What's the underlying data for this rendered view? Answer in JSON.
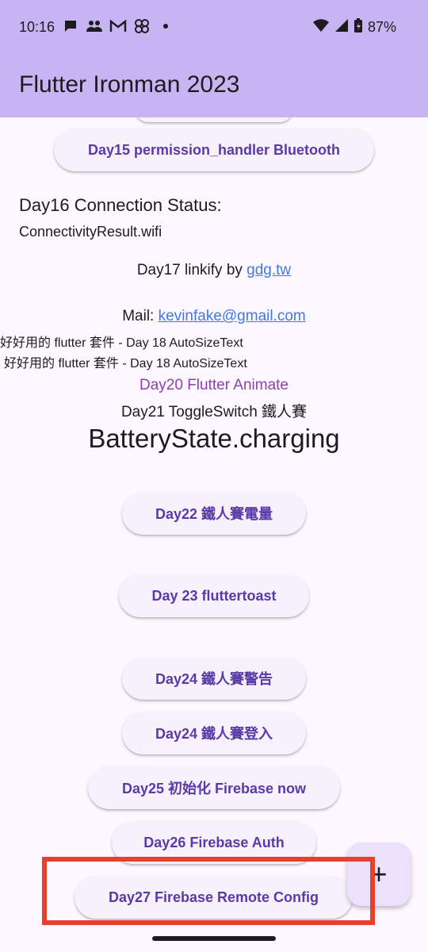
{
  "status_bar": {
    "time": "10:16",
    "battery": "87%",
    "icons": [
      "chat-icon",
      "people-icon",
      "gmail-icon",
      "pinwheel-icon",
      "dot-icon",
      "wifi-icon",
      "signal-icon",
      "battery-icon"
    ]
  },
  "app_bar": {
    "title": "Flutter Ironman 2023"
  },
  "content": {
    "btn_day15": "Day15 permission_handler Bluetooth",
    "day16_title": "Day16 Connection Status:",
    "day16_value": "ConnectivityResult.wifi",
    "day17_prefix": "Day17 linkify by ",
    "day17_link": "gdg.tw",
    "mail_prefix": "Mail: ",
    "mail_link": "kevinfake@gmail.com",
    "autosize_line1": "好好用的 flutter 套件 - Day 18 AutoSizeText",
    "autosize_line2": "好好用的 flutter 套件 - Day 18 AutoSizeText",
    "day20": "Day20 Flutter Animate",
    "day21": "Day21 ToggleSwitch 鐵人賽",
    "battery_state": "BatteryState.charging",
    "btn_day22": "Day22 鐵人賽電量",
    "btn_day23": "Day 23 fluttertoast",
    "btn_day24_alert": "Day24 鐵人賽警告",
    "btn_day24_login": "Day24 鐵人賽登入",
    "btn_day25": "Day25 初始化 Firebase now",
    "btn_day26": "Day26 Firebase Auth",
    "btn_day27": "Day27 Firebase Remote Config"
  },
  "fab": {
    "icon": "plus-icon",
    "label": "+"
  },
  "colors": {
    "app_bar": "#c7b4f2",
    "background": "#fdf7ff",
    "button_text": "#5a3aa8",
    "link": "#3d7ae8",
    "animate_text": "#8e3fb0",
    "highlight": "#e8402a"
  }
}
